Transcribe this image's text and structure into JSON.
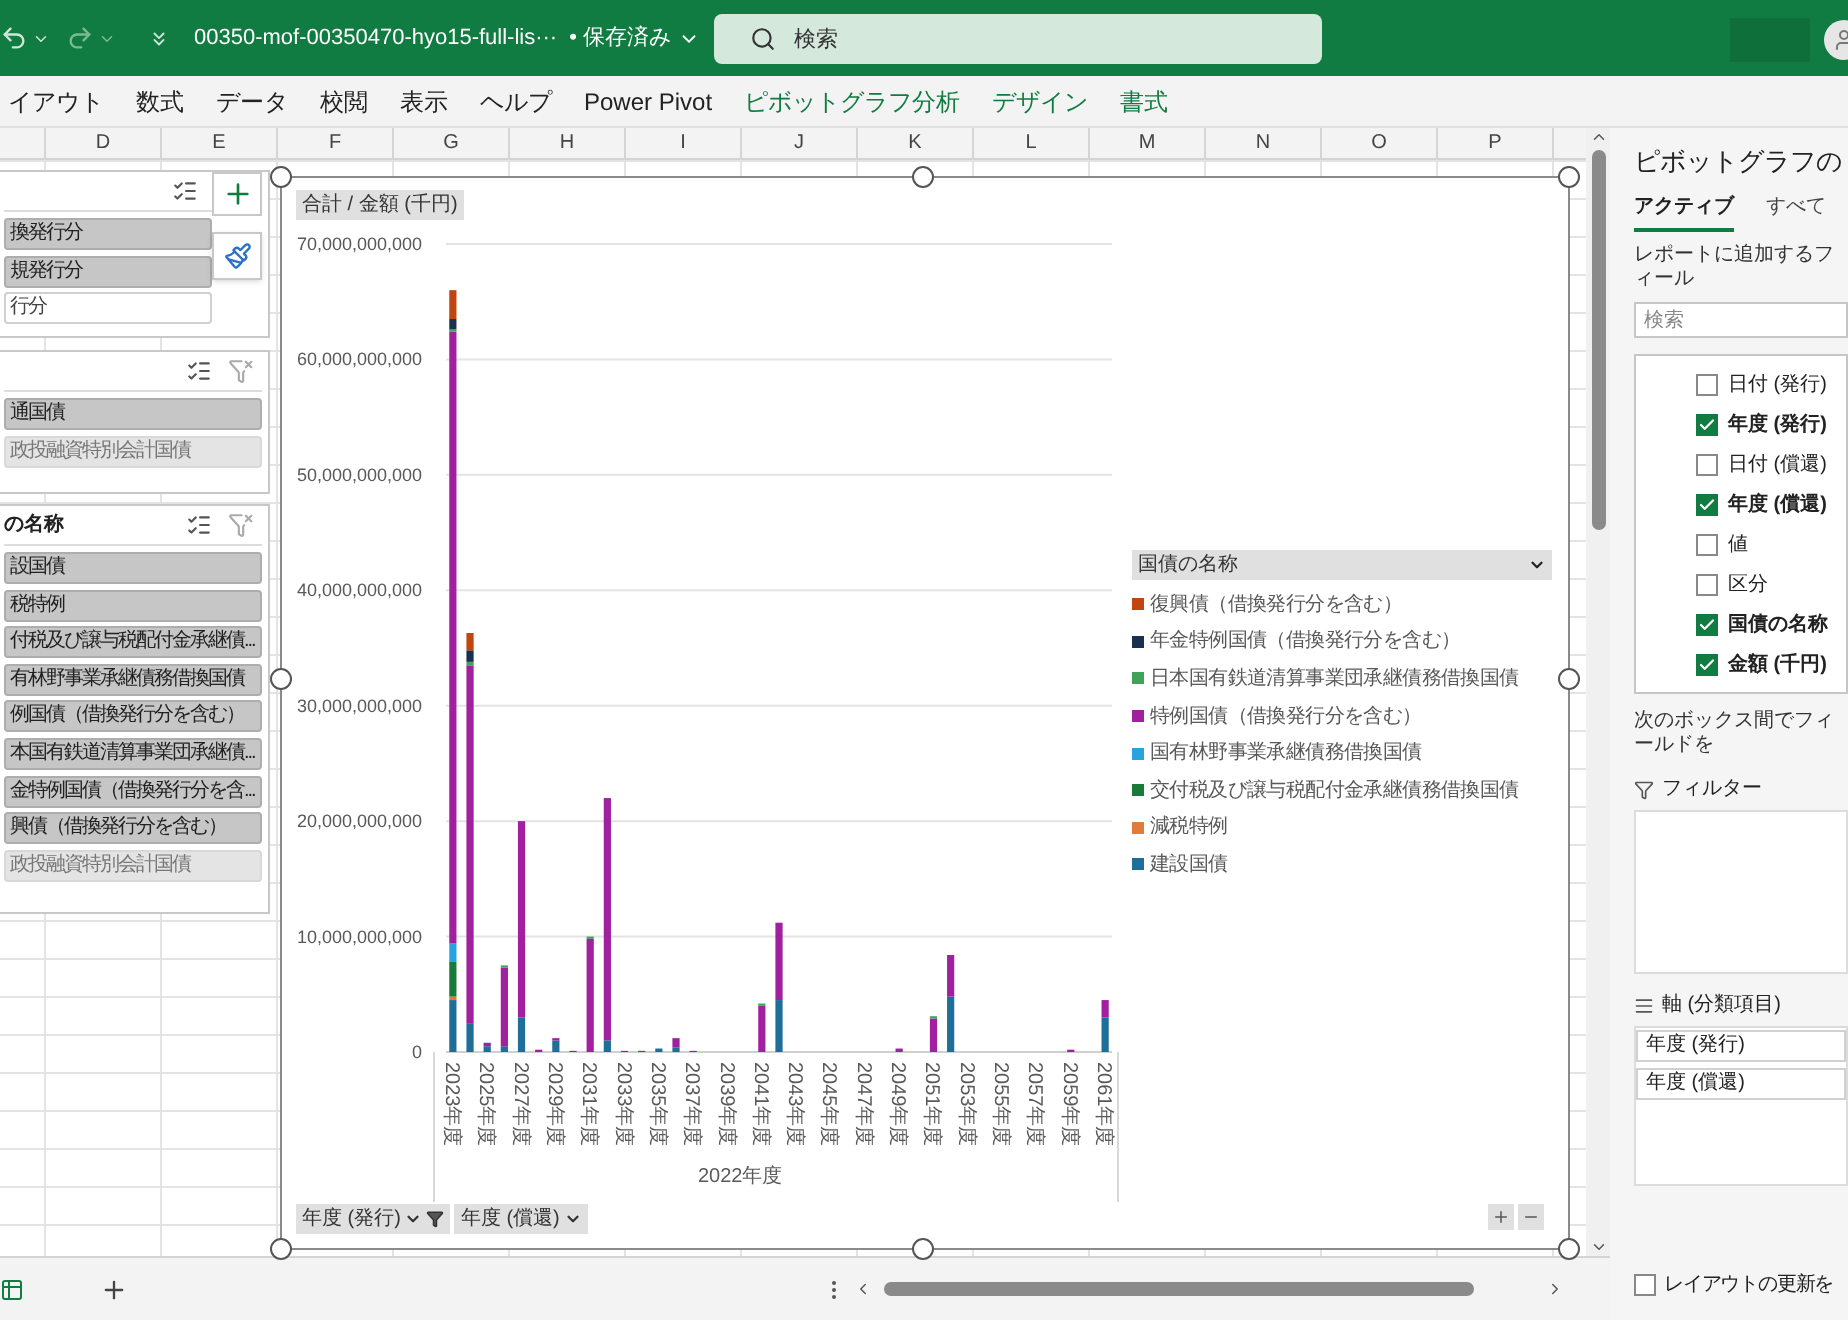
{
  "title_bar": {
    "filename": "00350-mof-00350470-hyo15-full-lis···",
    "save_status": "• 保存済み",
    "search": {
      "placeholder": "検索"
    }
  },
  "ribbon_tabs": [
    {
      "label": "イアウト",
      "kind": "normal"
    },
    {
      "label": "数式",
      "kind": "normal"
    },
    {
      "label": "データ",
      "kind": "normal"
    },
    {
      "label": "校閲",
      "kind": "normal"
    },
    {
      "label": "表示",
      "kind": "normal"
    },
    {
      "label": "ヘルプ",
      "kind": "normal"
    },
    {
      "label": "Power Pivot",
      "kind": "normal"
    },
    {
      "label": "ピボットグラフ分析",
      "kind": "contextual"
    },
    {
      "label": "デザイン",
      "kind": "contextual"
    },
    {
      "label": "書式",
      "kind": "contextual"
    }
  ],
  "column_headers": [
    "D",
    "E",
    "F",
    "G",
    "H",
    "I",
    "J",
    "K",
    "L",
    "M",
    "N",
    "O",
    "P"
  ],
  "slicers": [
    {
      "focused": true,
      "items": [
        {
          "label": "換発行分",
          "selected": true,
          "available": true
        },
        {
          "label": "規発行分",
          "selected": true,
          "available": true
        },
        {
          "label": "行分",
          "selected": false,
          "available": true
        }
      ]
    },
    {
      "focused": false,
      "items": [
        {
          "label": "通国債",
          "selected": true,
          "available": true
        },
        {
          "label": "政投融資特別会計国債",
          "selected": true,
          "available": false
        }
      ]
    },
    {
      "focused": false,
      "title": "の名称",
      "items": [
        {
          "label": "設国債",
          "selected": true,
          "available": true
        },
        {
          "label": "税特例",
          "selected": true,
          "available": true
        },
        {
          "label": "付税及び譲与税配付金承継債...",
          "selected": true,
          "available": true
        },
        {
          "label": "有林野事業承継債務借換国債",
          "selected": true,
          "available": true
        },
        {
          "label": "例国債（借換発行分を含む）",
          "selected": true,
          "available": true
        },
        {
          "label": "本国有鉄道清算事業団承継債...",
          "selected": true,
          "available": true
        },
        {
          "label": "金特例国債（借換発行分を含...",
          "selected": true,
          "available": true
        },
        {
          "label": "興債（借換発行分を含む）",
          "selected": true,
          "available": true
        },
        {
          "label": "政投融資特別会計国債",
          "selected": true,
          "available": false
        }
      ]
    }
  ],
  "chart": {
    "value_button": "合計 / 金額 (千円)",
    "axis_group": "2022年度",
    "legend_title": "国債の名称",
    "field_buttons": [
      {
        "label": "年度 (発行)",
        "filtered": true
      },
      {
        "label": "年度 (償還)",
        "filtered": false
      }
    ],
    "chart_data": {
      "type": "bar",
      "stacked": true,
      "grid": true,
      "ylim": [
        0,
        70000000000
      ],
      "xlim": [
        2022.6,
        2061.4
      ],
      "x": [
        2023,
        2024,
        2025,
        2026,
        2027,
        2028,
        2029,
        2030,
        2031,
        2032,
        2033,
        2034,
        2035,
        2036,
        2037,
        2038,
        2039,
        2040,
        2041,
        2042,
        2043,
        2044,
        2045,
        2046,
        2047,
        2048,
        2049,
        2050,
        2051,
        2052,
        2053,
        2054,
        2055,
        2056,
        2057,
        2058,
        2059,
        2060,
        2061
      ],
      "xticks": [
        {
          "value": 2023,
          "label": "2023年度"
        },
        {
          "value": 2025,
          "label": "2025年度"
        },
        {
          "value": 2027,
          "label": "2027年度"
        },
        {
          "value": 2029,
          "label": "2029年度"
        },
        {
          "value": 2031,
          "label": "2031年度"
        },
        {
          "value": 2033,
          "label": "2033年度"
        },
        {
          "value": 2035,
          "label": "2035年度"
        },
        {
          "value": 2037,
          "label": "2037年度"
        },
        {
          "value": 2039,
          "label": "2039年度"
        },
        {
          "value": 2041,
          "label": "2041年度"
        },
        {
          "value": 2043,
          "label": "2043年度"
        },
        {
          "value": 2045,
          "label": "2045年度"
        },
        {
          "value": 2047,
          "label": "2047年度"
        },
        {
          "value": 2049,
          "label": "2049年度"
        },
        {
          "value": 2051,
          "label": "2051年度"
        },
        {
          "value": 2053,
          "label": "2053年度"
        },
        {
          "value": 2055,
          "label": "2055年度"
        },
        {
          "value": 2057,
          "label": "2057年度"
        },
        {
          "value": 2059,
          "label": "2059年度"
        },
        {
          "value": 2061,
          "label": "2061年度"
        }
      ],
      "yticks": [
        {
          "value": 0,
          "label": "0"
        },
        {
          "value": 10000000000,
          "label": "10,000,000,000"
        },
        {
          "value": 20000000000,
          "label": "20,000,000,000"
        },
        {
          "value": 30000000000,
          "label": "30,000,000,000"
        },
        {
          "value": 40000000000,
          "label": "40,000,000,000"
        },
        {
          "value": 50000000000,
          "label": "50,000,000,000"
        },
        {
          "value": 60000000000,
          "label": "60,000,000,000"
        },
        {
          "value": 70000000000,
          "label": "70,000,000,000"
        }
      ],
      "series": [
        {
          "name": "建設国債",
          "color": "#1f6e99",
          "values": [
            4500000000.0,
            2500000000.0,
            500000000.0,
            500000000.0,
            3000000000.0,
            0,
            1000000000.0,
            0,
            0,
            1000000000.0,
            0,
            0,
            300000000.0,
            400000000.0,
            0,
            0,
            0,
            0,
            0,
            4500000000.0,
            0,
            0,
            0,
            0,
            0,
            0,
            0,
            0,
            0,
            4800000000.0,
            0,
            0,
            0,
            0,
            0,
            0,
            0,
            0,
            3000000000.0
          ]
        },
        {
          "name": "減税特例",
          "color": "#e07b39",
          "values": [
            300000000.0,
            0,
            0,
            0,
            0,
            0,
            0,
            0,
            0,
            0,
            0,
            0,
            0,
            0,
            0,
            0,
            0,
            0,
            0,
            0,
            0,
            0,
            0,
            0,
            0,
            0,
            0,
            0,
            0,
            0,
            0,
            0,
            0,
            0,
            0,
            0,
            0,
            0,
            0
          ]
        },
        {
          "name": "交付税及び譲与税配付金承継債務借換国債",
          "color": "#1a7a3a",
          "values": [
            3000000000.0,
            0,
            0,
            0,
            0,
            0,
            0,
            0,
            0,
            0,
            0,
            0,
            0,
            0,
            0,
            0,
            0,
            0,
            0,
            0,
            0,
            0,
            0,
            0,
            0,
            0,
            0,
            0,
            0,
            0,
            0,
            0,
            0,
            0,
            0,
            0,
            0,
            0,
            0
          ]
        },
        {
          "name": "国有林野事業承継債務借換国債",
          "color": "#29a3e0",
          "values": [
            1600000000.0,
            0,
            0,
            0,
            0,
            0,
            0,
            0,
            0,
            0,
            0,
            0,
            0,
            0,
            0,
            0,
            0,
            0,
            0,
            0,
            0,
            0,
            0,
            0,
            0,
            0,
            0,
            0,
            0,
            0,
            0,
            0,
            0,
            0,
            0,
            0,
            0,
            0,
            0
          ]
        },
        {
          "name": "特例国債（借換発行分を含む）",
          "color": "#a020a0",
          "values": [
            53000000000.0,
            31000000000.0,
            300000000.0,
            6800000000.0,
            17000000000.0,
            200000000.0,
            200000000.0,
            100000000.0,
            9800000000.0,
            21000000000.0,
            100000000.0,
            100000000.0,
            0,
            800000000.0,
            100000000.0,
            0,
            0,
            0,
            4000000000.0,
            6700000000.0,
            0,
            0,
            0,
            0,
            0,
            0,
            300000000.0,
            0,
            2900000000.0,
            3600000000.0,
            0,
            0,
            0,
            0,
            0,
            0,
            200000000.0,
            0,
            1500000000.0
          ]
        },
        {
          "name": "日本国有鉄道清算事業団承継債務借換国債",
          "color": "#3fa35a",
          "values": [
            200000000.0,
            300000000.0,
            0,
            200000000.0,
            0,
            0,
            0,
            0,
            200000000.0,
            0,
            0,
            0,
            0,
            0,
            0,
            0,
            0,
            0,
            200000000.0,
            0,
            0,
            0,
            0,
            0,
            0,
            0,
            0,
            0,
            200000000.0,
            0,
            0,
            0,
            0,
            0,
            0,
            0,
            0,
            0,
            0
          ]
        },
        {
          "name": "年金特例国債（借換発行分を含む）",
          "color": "#1b2f4f",
          "values": [
            900000000.0,
            1000000000.0,
            0,
            0,
            0,
            0,
            0,
            0,
            0,
            0,
            0,
            0,
            0,
            0,
            0,
            0,
            0,
            0,
            0,
            0,
            0,
            0,
            0,
            0,
            0,
            0,
            0,
            0,
            0,
            0,
            0,
            0,
            0,
            0,
            0,
            0,
            0,
            0,
            0
          ]
        },
        {
          "name": "復興債（借換発行分を含む）",
          "color": "#c0450f",
          "values": [
            2500000000.0,
            1500000000.0,
            0,
            0,
            0,
            0,
            0,
            0,
            0,
            0,
            0,
            0,
            0,
            0,
            0,
            0,
            0,
            0,
            0,
            0,
            0,
            0,
            0,
            0,
            0,
            0,
            0,
            0,
            0,
            0,
            0,
            0,
            0,
            0,
            0,
            0,
            0,
            0,
            0
          ]
        }
      ]
    }
  },
  "field_pane": {
    "title": "ピボットグラフの",
    "tabs": [
      {
        "label": "アクティブ",
        "selected": true
      },
      {
        "label": "すべて",
        "selected": false
      }
    ],
    "instruction": "レポートに追加するフィール",
    "search": {
      "placeholder": "検索"
    },
    "fields": [
      {
        "label": "日付 (発行)",
        "checked": false
      },
      {
        "label": "年度 (発行)",
        "checked": true
      },
      {
        "label": "日付 (償還)",
        "checked": false
      },
      {
        "label": "年度 (償還)",
        "checked": true
      },
      {
        "label": "値",
        "checked": false
      },
      {
        "label": "区分",
        "checked": false
      },
      {
        "label": "国債の名称",
        "checked": true
      },
      {
        "label": "金額 (千円)",
        "checked": true
      }
    ],
    "areas_instruction": "次のボックス間でフィールドを",
    "filter_area": {
      "title": "フィルター"
    },
    "axis_area": {
      "title": "軸 (分類項目)",
      "items": [
        "年度 (発行)",
        "年度 (償還)"
      ]
    },
    "defer_update": {
      "label": "レイアウトの更新を",
      "checked": false
    }
  }
}
